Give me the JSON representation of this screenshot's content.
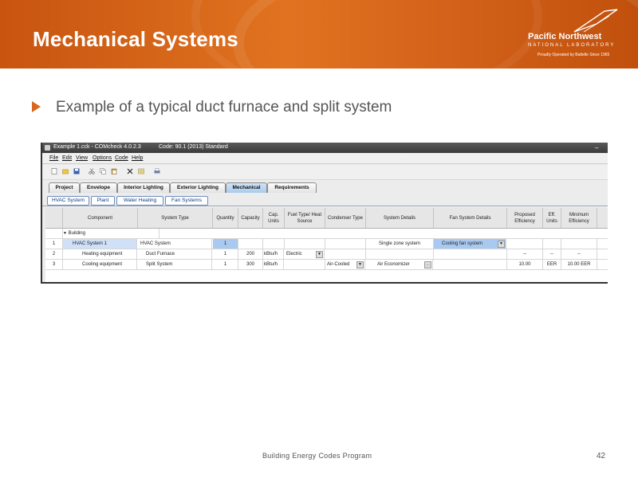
{
  "slide": {
    "title": "Mechanical Systems",
    "bullet": "Example of a typical duct furnace and split system",
    "logo_main": "Pacific Northwest",
    "logo_sub": "NATIONAL LABORATORY",
    "logo_tag": "Proudly Operated by Battelle Since 1965",
    "footer": "Building Energy Codes Program",
    "page_number": "42",
    "colors": {
      "header_orange": "#d9661e",
      "bullet_arrow": "#d9661e"
    }
  },
  "app": {
    "window_title": "Example 1.cck - COMcheck 4.0.2.3",
    "code_label": "Code: 90.1 (2013) Standard",
    "menu": [
      "File",
      "Edit",
      "View",
      "Options",
      "Code",
      "Help"
    ],
    "toolbar_icons": [
      "new-file-icon",
      "open-folder-icon",
      "save-icon",
      "cut-icon",
      "copy-icon",
      "paste-icon",
      "delete-icon",
      "add-row-icon",
      "print-icon"
    ],
    "main_tabs": [
      "Project",
      "Envelope",
      "Interior Lighting",
      "Exterior Lighting",
      "Mechanical",
      "Requirements"
    ],
    "active_main_tab": "Mechanical",
    "sub_tabs": [
      "HVAC System",
      "Plant",
      "Water Heating",
      "Fan Systems"
    ],
    "table": {
      "headers": [
        "",
        "Component",
        "System Type",
        "Quantity",
        "Capacity",
        "Cap. Units",
        "Fuel Type/ Heat Source",
        "Condenser Type",
        "System Details",
        "Fan System Details",
        "Proposed Efficiency",
        "Eff. Units",
        "Minimum Efficiency"
      ],
      "building_label": "Building",
      "rows": [
        {
          "num": "1",
          "component": "HVAC System 1",
          "system_type": "HVAC System",
          "quantity": "1",
          "capacity": "",
          "cap_units": "",
          "fuel": "",
          "condenser": "",
          "details": "Single zone system",
          "fan": "Cooling fan system",
          "proposed": "",
          "eff_units": "",
          "minimum": ""
        },
        {
          "num": "2",
          "component": "Heating equipment",
          "system_type": "Duct Furnace",
          "quantity": "1",
          "capacity": "200",
          "cap_units": "kBtu/h",
          "fuel": "Electric",
          "condenser": "",
          "details": "",
          "fan": "",
          "proposed": "--",
          "eff_units": "--",
          "minimum": "--"
        },
        {
          "num": "3",
          "component": "Cooling equipment",
          "system_type": "Split System",
          "quantity": "1",
          "capacity": "300",
          "cap_units": "kBtu/h",
          "fuel": "",
          "condenser": "Air-Cooled",
          "details": "Air Economizer",
          "fan": "",
          "proposed": "10.00",
          "eff_units": "EER",
          "minimum": "10.00 EER"
        }
      ]
    }
  }
}
